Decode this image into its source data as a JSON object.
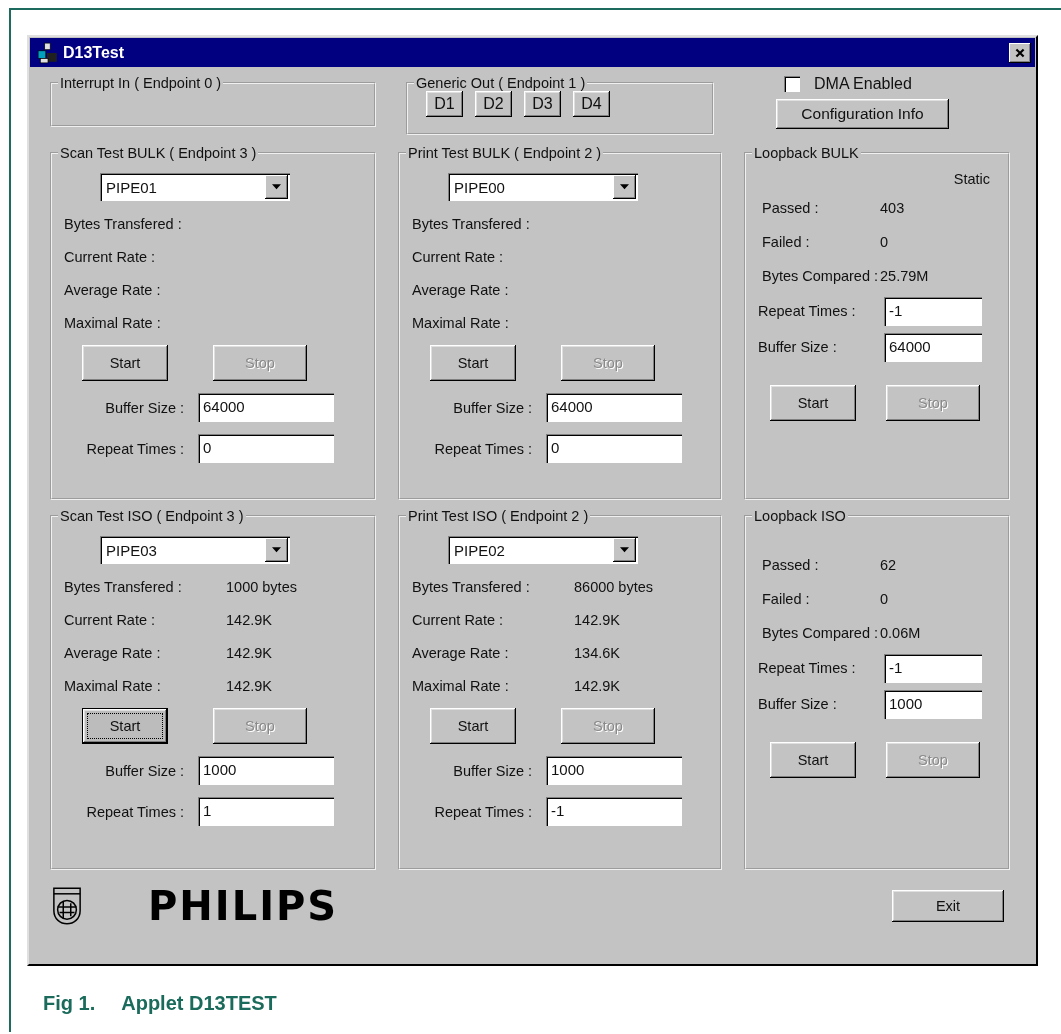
{
  "window": {
    "title": "D13Test"
  },
  "interrupt_in": {
    "title": "Interrupt In ( Endpoint 0 )"
  },
  "generic_out": {
    "title": "Generic Out ( Endpoint 1 )",
    "buttons": [
      "D1",
      "D2",
      "D3",
      "D4"
    ]
  },
  "dma": {
    "label": "DMA Enabled",
    "checked": false
  },
  "config_button": "Configuration Info",
  "test_groups": [
    {
      "title": "Scan Test BULK ( Endpoint 3 )",
      "pipe": "PIPE01",
      "stats": [
        {
          "label": "Bytes Transfered :"
        },
        {
          "label": "Current Rate :"
        },
        {
          "label": "Average Rate :"
        },
        {
          "label": "Maximal Rate :"
        }
      ],
      "start": {
        "label": "Start",
        "focused": false
      },
      "stop": {
        "label": "Stop",
        "disabled": true
      },
      "fields": [
        {
          "label": "Buffer Size :",
          "value": "64000"
        },
        {
          "label": "Repeat Times :",
          "value": "0"
        }
      ]
    },
    {
      "title": "Print Test BULK ( Endpoint 2 )",
      "pipe": "PIPE00",
      "stats": [
        {
          "label": "Bytes Transfered :"
        },
        {
          "label": "Current Rate :"
        },
        {
          "label": "Average Rate :"
        },
        {
          "label": "Maximal Rate :"
        }
      ],
      "start": {
        "label": "Start",
        "focused": false
      },
      "stop": {
        "label": "Stop",
        "disabled": true
      },
      "fields": [
        {
          "label": "Buffer Size :",
          "value": "64000"
        },
        {
          "label": "Repeat Times :",
          "value": "0"
        }
      ]
    },
    {
      "title": "Loopback BULK",
      "kind": "loopback",
      "mode": "Static",
      "stats": [
        {
          "label": "Passed :",
          "value": "403"
        },
        {
          "label": "Failed :",
          "value": "0"
        },
        {
          "label": "Bytes Compared :",
          "value": "25.79M"
        }
      ],
      "fields": [
        {
          "label": "Repeat Times :",
          "value": "-1"
        },
        {
          "label": "Buffer Size :",
          "value": "64000"
        }
      ],
      "start": {
        "label": "Start",
        "focused": false
      },
      "stop": {
        "label": "Stop",
        "disabled": true
      }
    },
    {
      "title": "Scan Test ISO ( Endpoint 3 )",
      "pipe": "PIPE03",
      "stats": [
        {
          "label": "Bytes Transfered :",
          "value": "1000 bytes"
        },
        {
          "label": "Current Rate :",
          "value": "142.9K"
        },
        {
          "label": "Average Rate :",
          "value": "142.9K"
        },
        {
          "label": "Maximal Rate :",
          "value": "142.9K"
        }
      ],
      "start": {
        "label": "Start",
        "focused": true
      },
      "stop": {
        "label": "Stop",
        "disabled": true
      },
      "fields": [
        {
          "label": "Buffer Size :",
          "value": "1000"
        },
        {
          "label": "Repeat Times :",
          "value": "1"
        }
      ]
    },
    {
      "title": "Print Test ISO ( Endpoint 2 )",
      "pipe": "PIPE02",
      "stats": [
        {
          "label": "Bytes Transfered :",
          "value": "86000 bytes"
        },
        {
          "label": "Current Rate :",
          "value": "142.9K"
        },
        {
          "label": "Average Rate :",
          "value": "134.6K"
        },
        {
          "label": "Maximal Rate :",
          "value": "142.9K"
        }
      ],
      "start": {
        "label": "Start",
        "focused": false
      },
      "stop": {
        "label": "Stop",
        "disabled": true
      },
      "fields": [
        {
          "label": "Buffer Size :",
          "value": "1000"
        },
        {
          "label": "Repeat Times :",
          "value": "-1"
        }
      ]
    },
    {
      "title": "Loopback ISO",
      "kind": "loopback",
      "stats": [
        {
          "label": "Passed :",
          "value": "62"
        },
        {
          "label": "Failed :",
          "value": "0"
        },
        {
          "label": "Bytes Compared :",
          "value": "0.06M"
        }
      ],
      "fields": [
        {
          "label": "Repeat Times :",
          "value": "-1"
        },
        {
          "label": "Buffer Size :",
          "value": "1000"
        }
      ],
      "start": {
        "label": "Start",
        "focused": false
      },
      "stop": {
        "label": "Stop",
        "disabled": true
      }
    }
  ],
  "logo": {
    "text": "PHILIPS"
  },
  "exit_button": "Exit",
  "caption": {
    "number": "Fig 1.",
    "text": "Applet D13TEST"
  }
}
